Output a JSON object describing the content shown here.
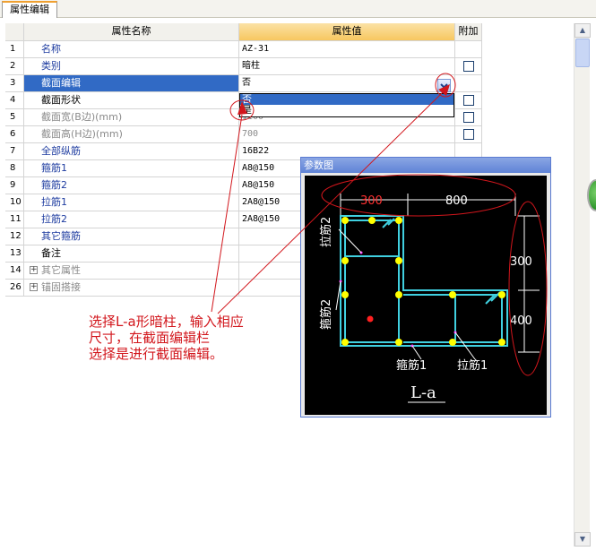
{
  "tab": {
    "label": "属性编辑"
  },
  "grid": {
    "headers": {
      "name": "属性名称",
      "value": "属性值",
      "add": "附加"
    },
    "rows": [
      {
        "num": "1",
        "name": "名称",
        "value": "AZ-31",
        "style": "blue",
        "checkbox": false
      },
      {
        "num": "2",
        "name": "类别",
        "value": "暗柱",
        "style": "blue",
        "checkbox": true
      },
      {
        "num": "3",
        "name": "截面编辑",
        "value": "否",
        "style": "selected",
        "checkbox": false
      },
      {
        "num": "4",
        "name": "截面形状",
        "value": "",
        "style": "black",
        "checkbox": true
      },
      {
        "num": "5",
        "name": "截面宽(B边)(mm)",
        "value": "1100",
        "style": "gray",
        "checkbox": true
      },
      {
        "num": "6",
        "name": "截面高(H边)(mm)",
        "value": "700",
        "style": "gray",
        "checkbox": true
      },
      {
        "num": "7",
        "name": "全部纵筋",
        "value": "16B22",
        "style": "blue",
        "checkbox": false
      },
      {
        "num": "8",
        "name": "箍筋1",
        "value": "A8@150",
        "style": "blue",
        "checkbox": false
      },
      {
        "num": "9",
        "name": "箍筋2",
        "value": "A8@150",
        "style": "blue",
        "checkbox": false
      },
      {
        "num": "10",
        "name": "拉筋1",
        "value": "2A8@150",
        "style": "blue",
        "checkbox": false
      },
      {
        "num": "11",
        "name": "拉筋2",
        "value": "2A8@150",
        "style": "blue",
        "checkbox": false
      },
      {
        "num": "12",
        "name": "其它箍筋",
        "value": "",
        "style": "blue",
        "checkbox": false
      },
      {
        "num": "13",
        "name": "备注",
        "value": "",
        "style": "black",
        "checkbox": false
      },
      {
        "num": "14",
        "name": "其它属性",
        "value": "",
        "style": "gray",
        "expand": "+",
        "checkbox": false
      },
      {
        "num": "26",
        "name": "锚固搭接",
        "value": "",
        "style": "gray",
        "expand": "+",
        "checkbox": false
      }
    ]
  },
  "dropdown": {
    "options": [
      "否",
      "是"
    ],
    "highlighted": "否"
  },
  "panel": {
    "title": "参数图",
    "dims": {
      "d300_top": "300",
      "d800": "800",
      "d300_right": "300",
      "d400": "400"
    },
    "labels": {
      "lajin2": "拉筋2",
      "gujin2": "箍筋2",
      "gujin1": "箍筋1",
      "lajin1": "拉筋1",
      "shape": "L-a"
    }
  },
  "annotation": {
    "lines": [
      "选择L-a形暗柱，输入相应",
      "尺寸，在截面编辑栏",
      "选择是进行截面编辑。"
    ]
  },
  "colors": {
    "selection": "#316ac5",
    "annotation": "#d2161c",
    "rebar": "#40d0e0",
    "bar": "#ffff00"
  }
}
